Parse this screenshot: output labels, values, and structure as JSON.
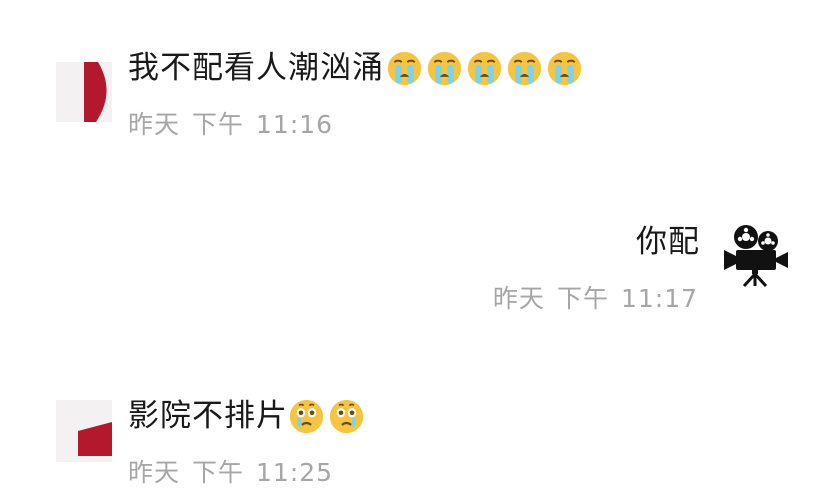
{
  "messages": [
    {
      "side": "left",
      "text": "我不配看人潮汹涌",
      "emoji": [
        "crying-face",
        "crying-face",
        "crying-face",
        "crying-face",
        "crying-face"
      ],
      "time_day": "昨天",
      "time_period": "下午",
      "time_clock": "11:16"
    },
    {
      "side": "right",
      "text": "你配",
      "emoji": [],
      "time_day": "昨天",
      "time_period": "下午",
      "time_clock": "11:17"
    },
    {
      "side": "left",
      "text": "影院不排片",
      "emoji": [
        "face-holding-back-tears",
        "face-holding-back-tears"
      ],
      "time_day": "昨天",
      "time_period": "下午",
      "time_clock": "11:25"
    }
  ],
  "colors": {
    "avatar_red": "#b3182c",
    "avatar_bg": "#f4f1f2",
    "text": "#1a1a1a",
    "time": "#a6a6a6",
    "emoji_face": "#f5c542",
    "emoji_tear": "#7fd3e6"
  }
}
